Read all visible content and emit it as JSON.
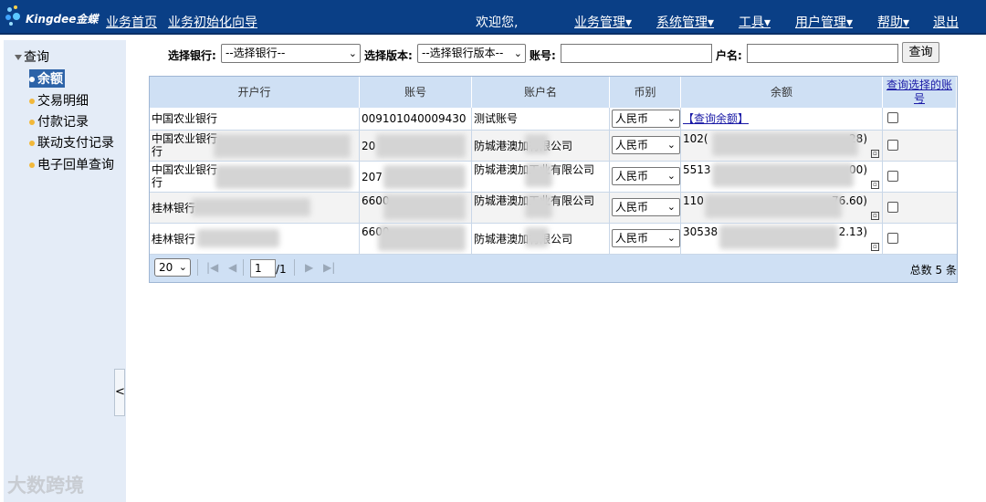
{
  "app": {
    "logo_text": "Kingdee金蝶",
    "nav": {
      "home": "业务首页",
      "wizard": "业务初始化向导",
      "welcome": "欢迎您,",
      "biz_mgmt": "业务管理▾",
      "sys_mgmt": "系统管理▾",
      "tools": "工具▾",
      "user_mgmt": "用户管理▾",
      "help": "帮助▾",
      "logout": "退出"
    },
    "colors": {
      "topbar": "#0a3f86",
      "sidebar": "#e4ecf7",
      "header": "#cfe0f4",
      "active_item": "#2d63a8"
    }
  },
  "sidebar": {
    "root": "查询",
    "items": [
      {
        "label": "余额",
        "active": true
      },
      {
        "label": "交易明细"
      },
      {
        "label": "付款记录"
      },
      {
        "label": "联动支付记录"
      },
      {
        "label": "电子回单查询"
      }
    ],
    "collapse": "<"
  },
  "watermark": "大数跨境",
  "filters": {
    "bank_label": "选择银行:",
    "bank_value": "--选择银行--",
    "version_label": "选择版本:",
    "version_value": "--选择银行版本--",
    "account_label": "账号:",
    "account_value": "",
    "name_label": "户名:",
    "name_value": "",
    "query_button": "查询"
  },
  "grid": {
    "columns": [
      "开户行",
      "账号",
      "账户名",
      "币别",
      "余额",
      "查询选择的账号"
    ],
    "rows": [
      {
        "bank": "中国农业银行",
        "account": "009101040009430",
        "name": "测试账号",
        "currency": "人民币",
        "balance": "【查询余额】"
      },
      {
        "bank": "中国农业银行",
        "account": "20",
        "name": "防城港澳加有限公司",
        "currency": "人民币",
        "balance": "102(",
        "balance_tail": "28)"
      },
      {
        "bank": "中国农业银行",
        "account": "207",
        "name": "防城港澳加工业有限公司",
        "currency": "人民币",
        "balance": "5513",
        "balance_tail": "00)"
      },
      {
        "bank": "桂林银行",
        "account": "6600",
        "name": "防城港澳加工业有限公司",
        "currency": "人民币",
        "balance": "110",
        "balance_tail": "76.60)"
      },
      {
        "bank": "桂林银行",
        "account": "6600",
        "name": "防城港澳加有限公司",
        "currency": "人民币",
        "balance": "30538",
        "balance_tail": "2.13)"
      }
    ]
  },
  "pager": {
    "page_size": "20",
    "first": "|◀",
    "prev": "◀",
    "page": "1",
    "total_pages": "/1",
    "next": "▶",
    "last": "▶|",
    "total_text": "总数 5 条"
  }
}
